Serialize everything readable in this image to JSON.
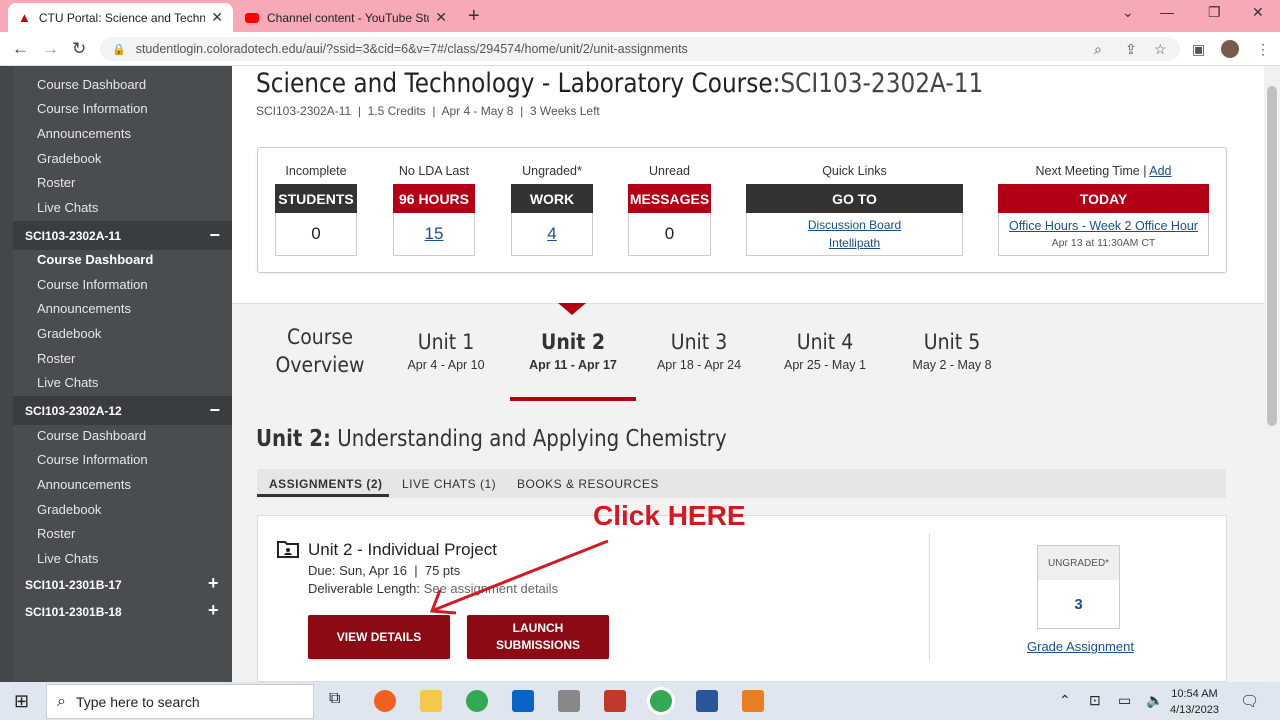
{
  "browser": {
    "tabs": [
      {
        "title": "CTU Portal: Science and Technolo",
        "icon": "ctu-icon",
        "active": true
      },
      {
        "title": "Channel content - YouTube Studi",
        "icon": "youtube-icon",
        "active": false
      }
    ],
    "new_tab": "+",
    "url": "studentlogin.coloradotech.edu/aui/?ssid=3&cid=6&v=7#/class/294574/home/unit/2/unit-assignments"
  },
  "sidebar": {
    "group0": [
      "Course Dashboard",
      "Course Information",
      "Announcements",
      "Gradebook",
      "Roster",
      "Live Chats"
    ],
    "section1": {
      "title": "SCI103-2302A-11",
      "toggle": "−"
    },
    "group1": [
      "Course Dashboard",
      "Course Information",
      "Announcements",
      "Gradebook",
      "Roster",
      "Live Chats"
    ],
    "section2": {
      "title": "SCI103-2302A-12",
      "toggle": "−"
    },
    "group2": [
      "Course Dashboard",
      "Course Information",
      "Announcements",
      "Gradebook",
      "Roster",
      "Live Chats"
    ],
    "section3": {
      "title": "SCI101-2301B-17",
      "toggle": "+"
    },
    "section4": {
      "title": "SCI101-2301B-18",
      "toggle": "+"
    }
  },
  "course": {
    "title": "Science and Technology - Laboratory Course:",
    "code": "SCI103-2302A-11",
    "meta": "SCI103-2302A-11  |  1.5 Credits  |  Apr 4 - May 8  |  3 Weeks Left"
  },
  "stats": {
    "incomplete": {
      "label": "Incomplete",
      "header": "STUDENTS",
      "value": "0"
    },
    "lda": {
      "label": "No LDA Last",
      "header": "96 HOURS",
      "value": "15"
    },
    "ungraded": {
      "label": "Ungraded*",
      "header": "WORK",
      "value": "4"
    },
    "unread": {
      "label": "Unread",
      "header": "MESSAGES",
      "value": "0"
    },
    "quick": {
      "label": "Quick Links",
      "header": "GO TO",
      "link1": "Discussion Board",
      "link2": "Intellipath"
    },
    "meeting": {
      "label": "Next Meeting Time",
      "sep": "|",
      "add": "Add",
      "header": "TODAY",
      "link": "Office Hours - Week 2 Office Hour",
      "time": "Apr 13 at 11:30AM CT"
    }
  },
  "units": [
    {
      "name": "Course",
      "name2": "Overview"
    },
    {
      "name": "Unit 1",
      "dates": "Apr 4 - Apr 10"
    },
    {
      "name": "Unit 2",
      "dates": "Apr 11 - Apr 17"
    },
    {
      "name": "Unit 3",
      "dates": "Apr 18 - Apr 24"
    },
    {
      "name": "Unit 4",
      "dates": "Apr 25 - May 1"
    },
    {
      "name": "Unit 5",
      "dates": "May 2 - May 8"
    }
  ],
  "unit_heading": {
    "label": "Unit 2:",
    "title": "Understanding and Applying Chemistry"
  },
  "content_tabs": [
    "ASSIGNMENTS (2)",
    "LIVE CHATS (1)",
    "BOOKS & RESOURCES"
  ],
  "assignment": {
    "title": "Unit 2 - Individual Project",
    "due": "Due: Sun, Apr 16  |  75 pts",
    "deliv_label": "Deliverable Length:",
    "deliv_value": "See assignment details",
    "view_btn": "VIEW DETAILS",
    "launch_btn1": "LAUNCH",
    "launch_btn2": "SUBMISSIONS",
    "ungraded_label": "UNGRADED*",
    "ungraded_value": "3",
    "grade_link": "Grade Assignment"
  },
  "annotation": {
    "text": "Click HERE",
    "color": "#d11a22"
  },
  "taskbar": {
    "search_placeholder": "Type here to search",
    "time": "10:54 AM",
    "date": "4/13/2023"
  },
  "colors": {
    "accent_red": "#b30016",
    "dark_header": "#333333",
    "button_red": "#8b0a14",
    "link_blue": "#1a4f8b",
    "sidebar_bg": "#4a4d50"
  }
}
